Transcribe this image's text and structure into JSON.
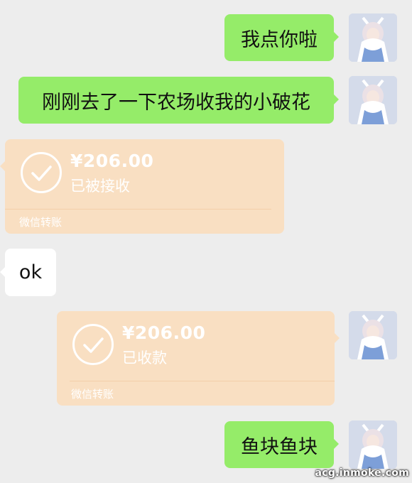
{
  "messages": [
    {
      "side": "right",
      "type": "text",
      "text": "我点你啦"
    },
    {
      "side": "right",
      "type": "text",
      "text": "刚刚去了一下农场收我的小破花"
    },
    {
      "side": "left",
      "type": "transfer",
      "amount": "¥206.00",
      "status": "已被接收",
      "footer": "微信转账"
    },
    {
      "side": "left",
      "type": "text",
      "text": "ok"
    },
    {
      "side": "right",
      "type": "transfer",
      "amount": "¥206.00",
      "status": "已收款",
      "footer": "微信转账"
    },
    {
      "side": "right",
      "type": "text",
      "text": "鱼块鱼块"
    }
  ],
  "watermark": "acg.inmoke.com",
  "colors": {
    "background": "#ededed",
    "sent_bubble": "#95ec69",
    "received_bubble": "#ffffff",
    "transfer_card": "#f9dfc2"
  },
  "icons": [
    "avatar-anime-girl",
    "check-circle-icon"
  ]
}
